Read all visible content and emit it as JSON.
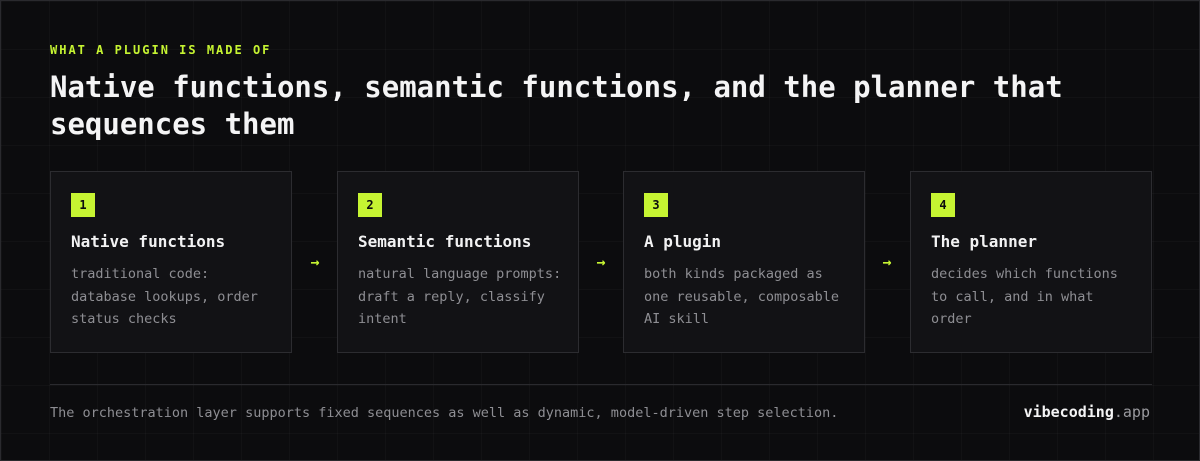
{
  "eyebrow": "WHAT A PLUGIN IS MADE OF",
  "title": "Native functions, semantic functions, and the planner that sequences them",
  "steps": [
    {
      "number": "1",
      "title": "Native functions",
      "description": "traditional code: database lookups, order status checks"
    },
    {
      "number": "2",
      "title": "Semantic functions",
      "description": "natural language prompts: draft a reply, classify intent"
    },
    {
      "number": "3",
      "title": "A plugin",
      "description": "both kinds packaged as one reusable, composable AI skill"
    },
    {
      "number": "4",
      "title": "The planner",
      "description": "decides which functions to call, and in what order"
    }
  ],
  "arrow_glyph": "→",
  "footer": {
    "note": "The orchestration layer supports fixed sequences as well as dynamic, model-driven step selection.",
    "brand_main": "vibecoding",
    "brand_tld": ".app"
  },
  "colors": {
    "accent": "#c6f432",
    "background": "#0c0c0e",
    "card": "#121215",
    "text": "#f4f4f5",
    "muted": "#8e8e93"
  }
}
